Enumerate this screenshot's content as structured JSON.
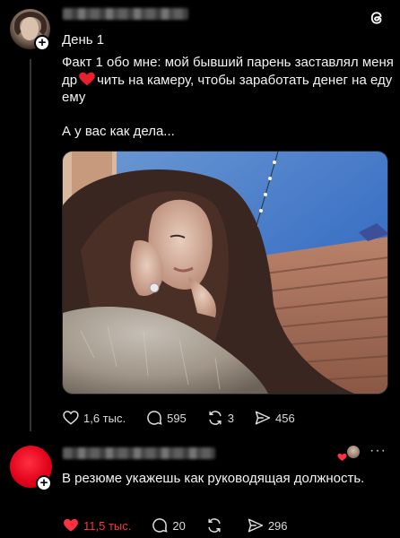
{
  "post": {
    "title": "День 1",
    "body_before_heart": "Факт 1 обо мне: мой бывший парень заставлял меня др",
    "body_after_heart": "чить на камеру, чтобы заработать денег на еду ему",
    "question": "А у вас как дела...",
    "likes": "1,6 тыс.",
    "comments": "595",
    "reposts": "3",
    "shares": "456",
    "icons": [
      "threads-logo-icon",
      "heart-icon",
      "comment-icon",
      "repost-icon",
      "share-icon",
      "plus-icon"
    ]
  },
  "reply": {
    "text": "В резюме укажешь как руководящая должность.",
    "likes": "11,5 тыс.",
    "comments": "20",
    "shares": "296",
    "more": "···",
    "icons": [
      "heart-filled-icon",
      "comment-icon",
      "repost-icon",
      "share-icon",
      "more-icon",
      "author-liked-heart-icon"
    ]
  },
  "colors": {
    "background": "#000000",
    "text": "#f3f3f3",
    "like_active": "#ff3040",
    "reply_avatar": "#e0001a"
  }
}
